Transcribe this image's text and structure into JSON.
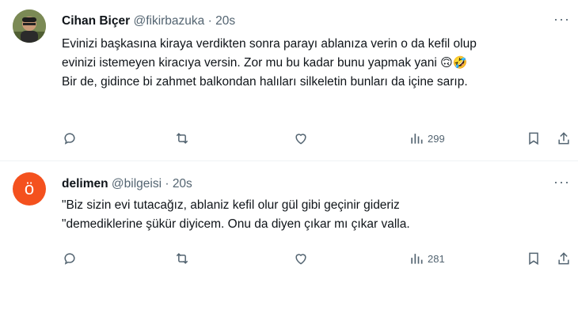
{
  "tweets": [
    {
      "name": "Cihan Biçer",
      "handle": "@fikirbazuka",
      "dot": "·",
      "time": "20s",
      "lines": [
        "Evinizi başkasına kiraya verdikten sonra parayı ablanıza verin o da kefil olup",
        "evinizi istemeyen kiracıya versin. Zor mu bu kadar bunu yapmak yani",
        "Bir de, gidince bi zahmet balkondan halıları silkeletin bunları da içine sarıp."
      ],
      "emojis": "🙃🤣",
      "views": "299"
    },
    {
      "name": "delimen",
      "handle": "@bilgeisi",
      "dot": "·",
      "time": "20s",
      "avatar_letter": "ö",
      "lines": [
        "\"Biz sizin evi tutacağız, ablaniz kefil olur gül gibi geçinir gideriz",
        "\"demediklerine şükür diyicem. Onu da diyen çıkar mı çıkar valla."
      ],
      "views": "281"
    }
  ],
  "more_label": "···",
  "icons": [
    "reply-icon",
    "retweet-icon",
    "like-icon",
    "views-icon",
    "bookmark-icon",
    "share-icon"
  ],
  "colors": {
    "text": "#0f1419",
    "secondary": "#536471",
    "avatar_letter_bg": "#f4511e",
    "divider": "#eff3f4"
  }
}
